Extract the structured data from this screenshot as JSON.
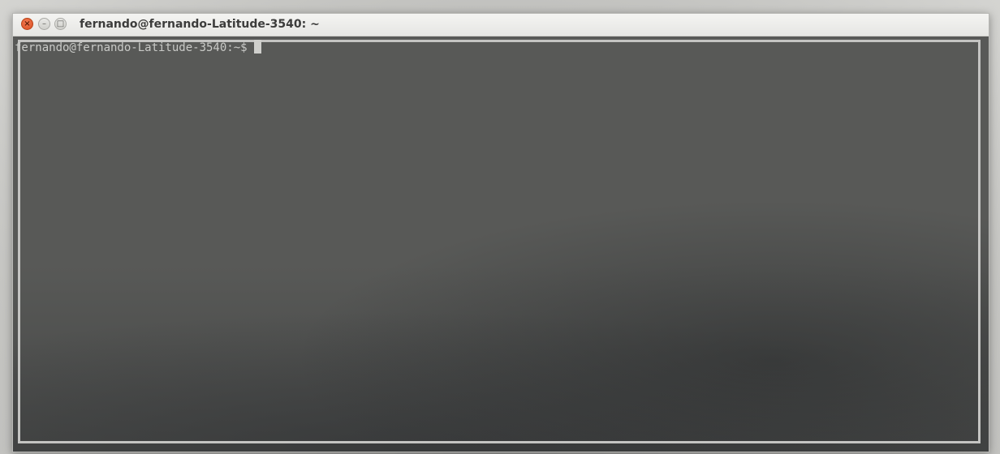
{
  "window": {
    "title": "fernando@fernando-Latitude-3540: ~",
    "controls": {
      "close_glyph": "×",
      "minimize_glyph": "–",
      "maximize_glyph": "□"
    }
  },
  "terminal": {
    "prompt": "fernando@fernando-Latitude-3540:~$"
  },
  "colors": {
    "terminal_bg": "#585957",
    "prompt_text": "#c9cac7",
    "close_button": "#e1592b"
  },
  "icons": {
    "close": "close-icon",
    "minimize": "minimize-icon",
    "maximize": "maximize-icon"
  }
}
